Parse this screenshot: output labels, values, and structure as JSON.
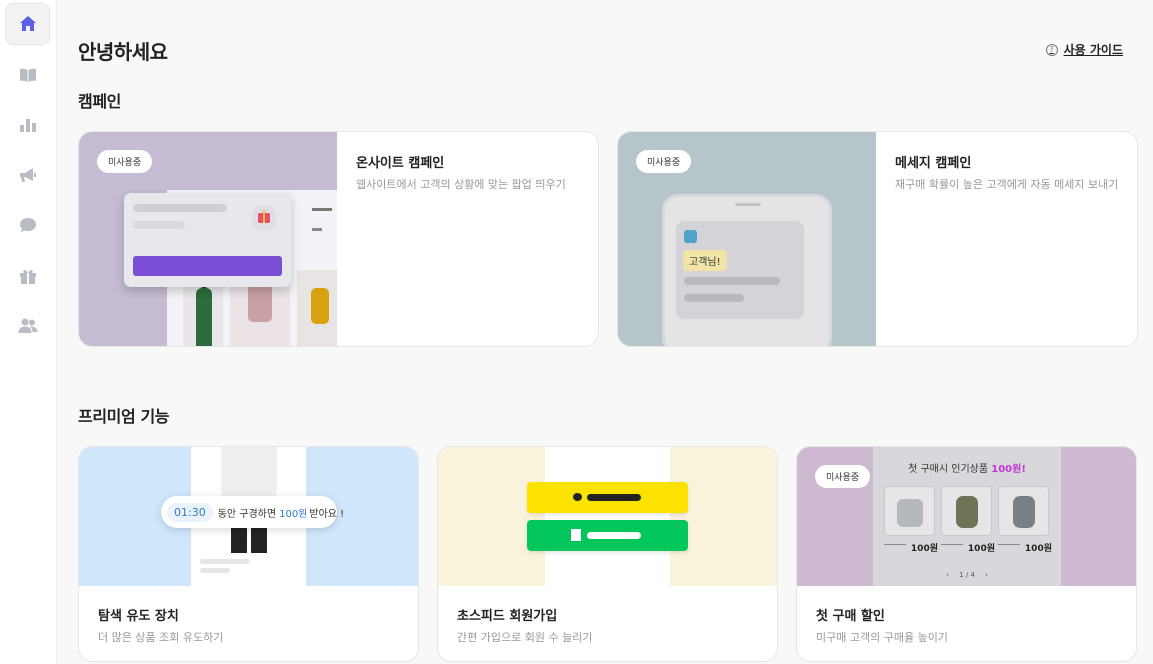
{
  "sidebar": {
    "items": [
      {
        "icon": "home-icon",
        "active": true
      },
      {
        "icon": "book-icon",
        "active": false
      },
      {
        "icon": "bar-chart-icon",
        "active": false
      },
      {
        "icon": "megaphone-icon",
        "active": false
      },
      {
        "icon": "chat-bubble-icon",
        "active": false
      },
      {
        "icon": "gift-icon",
        "active": false
      },
      {
        "icon": "users-icon",
        "active": false
      }
    ],
    "active_color": "#5b5fe8"
  },
  "header": {
    "greeting": "안녕하세요",
    "guide_label": "사용 가이드"
  },
  "campaign": {
    "section_title": "캠페인",
    "cards": [
      {
        "badge": "미사용중",
        "title": "온사이트 캠페인",
        "desc": "웹사이트에서 고객의 상황에 맞는 팝업 띄우기"
      },
      {
        "badge": "미사용중",
        "title": "메세지 캠페인",
        "desc": "재구매 확률이 높은 고객에게 자동 메세지 보내기",
        "bubble": "고객님!"
      }
    ]
  },
  "premium": {
    "section_title": "프리미엄 기능",
    "cards": [
      {
        "title": "탐색 유도 장치",
        "desc": "더 많은 상품 조회 유도하기",
        "timer": "01:30",
        "timer_pre": "동안 구경하면",
        "timer_amount": "100원",
        "timer_post": "받아요 !"
      },
      {
        "title": "초스피드 회원가입",
        "desc": "간편 가입으로 회원 수 늘리기"
      },
      {
        "badge": "미사용중",
        "title": "첫 구매 할인",
        "desc": "미구매 고객의 구매율 높이기",
        "promo_pre": "첫 구매시 인기상품",
        "promo_amount": "100원!",
        "price_label": "100원",
        "pager": "1 / 4"
      }
    ]
  }
}
